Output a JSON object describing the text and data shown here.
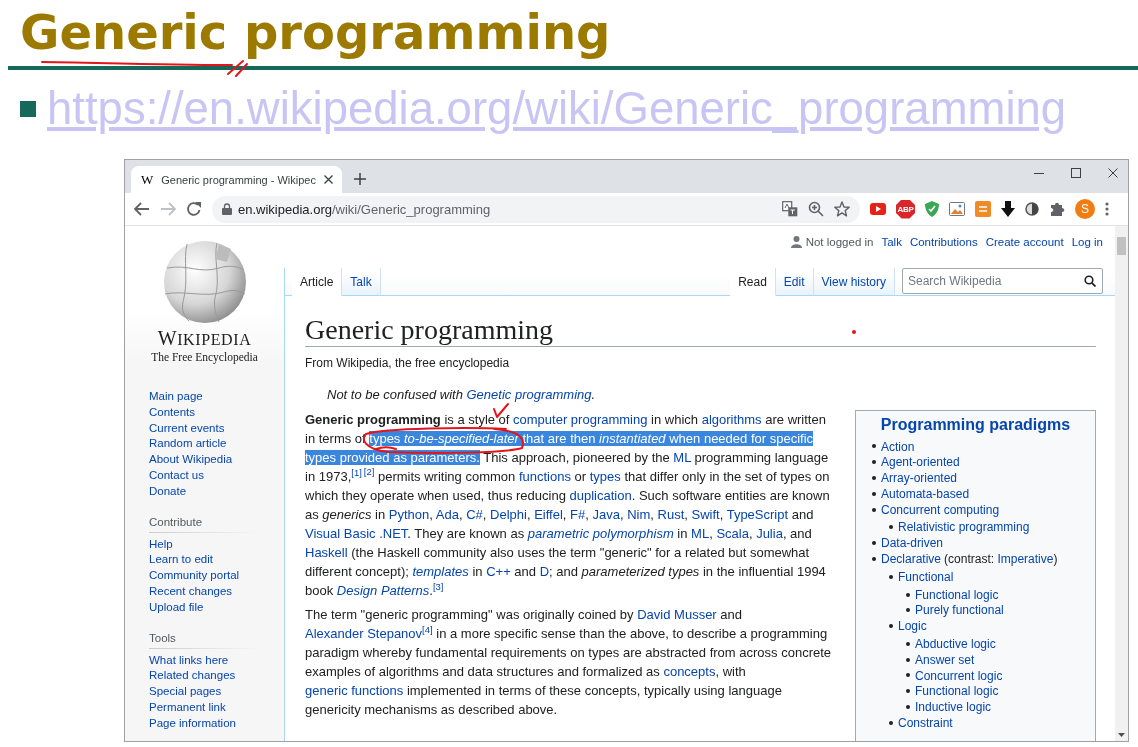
{
  "slide": {
    "title": "Generic programming",
    "bullet_link": "https://en.wikipedia.org/wiki/Generic_programming"
  },
  "ink_marks": [
    {
      "kind": "underline"
    },
    {
      "kind": "check"
    },
    {
      "kind": "circle"
    },
    {
      "kind": "dot"
    }
  ],
  "browser": {
    "tabs": [
      {
        "favicon": "W",
        "title": "Generic programming - Wikipec",
        "selected": true
      }
    ],
    "address": {
      "host": "en.wikipedia.org",
      "path": "/wiki/Generic_programming"
    },
    "extensions": [
      {
        "kind": "video"
      },
      {
        "kind": "octagon",
        "label": "ABP"
      },
      {
        "kind": "shield"
      },
      {
        "kind": "picture"
      },
      {
        "kind": "tile"
      },
      {
        "kind": "download"
      },
      {
        "kind": "circle"
      },
      {
        "kind": "puzzle"
      }
    ],
    "profile": {
      "initial": "S"
    }
  },
  "wiki": {
    "personal": [
      {
        "kind": "status",
        "text": "Not logged in"
      },
      {
        "kind": "link",
        "text": "Talk"
      },
      {
        "kind": "link",
        "text": "Contributions"
      },
      {
        "kind": "link",
        "text": "Create account"
      },
      {
        "kind": "link",
        "text": "Log in"
      }
    ],
    "logo": {
      "wordmark": "WIKIPEDIA",
      "tagline": "The Free Encyclopedia"
    },
    "sidebar": {
      "navigation": [
        "Main page",
        "Contents",
        "Current events",
        "Random article",
        "About Wikipedia",
        "Contact us",
        "Donate"
      ],
      "sections": [
        {
          "heading": "Contribute",
          "items": [
            "Help",
            "Learn to edit",
            "Community portal",
            "Recent changes",
            "Upload file"
          ]
        },
        {
          "heading": "Tools",
          "items": [
            "What links here",
            "Related changes",
            "Special pages",
            "Permanent link",
            "Page information"
          ]
        }
      ]
    },
    "namespace_tabs": [
      {
        "label": "Article",
        "selected": true
      },
      {
        "label": "Talk",
        "selected": false
      }
    ],
    "view_tabs": [
      {
        "label": "Read",
        "selected": true
      },
      {
        "label": "Edit",
        "selected": false
      },
      {
        "label": "View history",
        "selected": false
      }
    ],
    "search": {
      "placeholder": "Search Wikipedia"
    },
    "heading": "Generic programming",
    "tagline": "From Wikipedia, the free encyclopedia",
    "hatnote": [
      {
        "kind": "text",
        "text": "Not to be confused with "
      },
      {
        "kind": "link",
        "text": "Genetic programming"
      },
      {
        "kind": "text",
        "text": "."
      }
    ],
    "paragraphs": [
      [
        {
          "kind": "text",
          "text": "**Generic programming** is a style of "
        },
        {
          "kind": "link",
          "text": "computer programming"
        },
        {
          "kind": "text",
          "text": " in which "
        },
        {
          "kind": "link",
          "text": "algorithms"
        },
        {
          "kind": "text",
          "text": " are written in terms of "
        },
        {
          "kind": "highlighted",
          "text": "types *to-be-specified-later* that are then *instantiated* when needed for specific "
        },
        {
          "kind": "highlighted",
          "text": "types provided as parameters."
        },
        {
          "kind": "text",
          "text": " This approach, pioneered by the "
        },
        {
          "kind": "link",
          "text": "ML"
        },
        {
          "kind": "text",
          "text": " programming language in 1973,"
        },
        {
          "kind": "ref",
          "text": "[1]"
        },
        {
          "kind": "ref",
          "text": "[2]"
        },
        {
          "kind": "text",
          "text": " permits writing common "
        },
        {
          "kind": "link",
          "text": "functions"
        },
        {
          "kind": "text",
          "text": " or "
        },
        {
          "kind": "link",
          "text": "types"
        },
        {
          "kind": "text",
          "text": " that differ only in the set of types on which they operate when used, thus reducing "
        },
        {
          "kind": "link",
          "text": "duplication"
        },
        {
          "kind": "text",
          "text": ". Such software entities are known as *generics* in "
        },
        {
          "kind": "link",
          "text": "Python"
        },
        {
          "kind": "text",
          "text": ", "
        },
        {
          "kind": "link",
          "text": "Ada"
        },
        {
          "kind": "text",
          "text": ", "
        },
        {
          "kind": "link",
          "text": "C#"
        },
        {
          "kind": "text",
          "text": ", "
        },
        {
          "kind": "link",
          "text": "Delphi"
        },
        {
          "kind": "text",
          "text": ", "
        },
        {
          "kind": "link",
          "text": "Eiffel"
        },
        {
          "kind": "text",
          "text": ", "
        },
        {
          "kind": "link",
          "text": "F#"
        },
        {
          "kind": "text",
          "text": ", "
        },
        {
          "kind": "link",
          "text": "Java"
        },
        {
          "kind": "text",
          "text": ", "
        },
        {
          "kind": "link",
          "text": "Nim"
        },
        {
          "kind": "text",
          "text": ", "
        },
        {
          "kind": "link",
          "text": "Rust"
        },
        {
          "kind": "text",
          "text": ", "
        },
        {
          "kind": "link",
          "text": "Swift"
        },
        {
          "kind": "text",
          "text": ", "
        },
        {
          "kind": "link",
          "text": "TypeScript"
        },
        {
          "kind": "text",
          "text": " and "
        },
        {
          "kind": "link",
          "text": "Visual Basic .NET"
        },
        {
          "kind": "text",
          "text": ". They are known as "
        },
        {
          "kind": "italic-link",
          "text": "parametric polymorphism"
        },
        {
          "kind": "text",
          "text": " in "
        },
        {
          "kind": "link",
          "text": "ML"
        },
        {
          "kind": "text",
          "text": ", "
        },
        {
          "kind": "link",
          "text": "Scala"
        },
        {
          "kind": "text",
          "text": ", "
        },
        {
          "kind": "link",
          "text": "Julia"
        },
        {
          "kind": "text",
          "text": ", and "
        },
        {
          "kind": "link",
          "text": "Haskell"
        },
        {
          "kind": "text",
          "text": " (the Haskell community also uses the term \"generic\" for a related but somewhat different concept); "
        },
        {
          "kind": "italic-link",
          "text": "templates"
        },
        {
          "kind": "text",
          "text": " in "
        },
        {
          "kind": "link",
          "text": "C++"
        },
        {
          "kind": "text",
          "text": " and "
        },
        {
          "kind": "link",
          "text": "D"
        },
        {
          "kind": "text",
          "text": "; and *parameterized types* in the influential 1994 book "
        },
        {
          "kind": "italic-link",
          "text": "Design Patterns"
        },
        {
          "kind": "text",
          "text": "."
        },
        {
          "kind": "ref",
          "text": "[3]"
        }
      ],
      [
        {
          "kind": "text",
          "text": "The term \"generic programming\" was originally coined by "
        },
        {
          "kind": "link",
          "text": "David Musser"
        },
        {
          "kind": "text",
          "text": " and "
        },
        {
          "kind": "link",
          "text": "Alexander Stepanov"
        },
        {
          "kind": "ref",
          "text": "[4]"
        },
        {
          "kind": "text",
          "text": " in a more specific sense than the above, to describe a programming paradigm whereby fundamental requirements on types are abstracted from across concrete examples of algorithms and data structures and formalized as "
        },
        {
          "kind": "link",
          "text": "concepts"
        },
        {
          "kind": "text",
          "text": ", with "
        },
        {
          "kind": "link",
          "text": "generic functions"
        },
        {
          "kind": "text",
          "text": " implemented in terms of these concepts, typically using language genericity mechanisms as described above."
        }
      ]
    ],
    "infobox": {
      "title": "Programming paradigms",
      "items": [
        {
          "label": "Action"
        },
        {
          "label": "Agent-oriented"
        },
        {
          "label": "Array-oriented"
        },
        {
          "label": "Automata-based"
        },
        {
          "label": "Concurrent computing",
          "children": [
            {
              "label": "Relativistic programming"
            }
          ]
        },
        {
          "label": "Data-driven"
        },
        {
          "label": "Declarative",
          "note": [
            {
              "kind": "text",
              "text": "(contrast: "
            },
            {
              "kind": "link",
              "text": "Imperative"
            },
            {
              "kind": "text",
              "text": ")"
            }
          ],
          "children": [
            {
              "label": "Functional",
              "children": [
                {
                  "label": "Functional logic"
                },
                {
                  "label": "Purely functional"
                }
              ]
            },
            {
              "label": "Logic",
              "children": [
                {
                  "label": "Abductive logic"
                },
                {
                  "label": "Answer set"
                },
                {
                  "label": "Concurrent logic"
                },
                {
                  "label": "Functional logic"
                },
                {
                  "label": "Inductive logic"
                }
              ]
            },
            {
              "label": "Constraint"
            }
          ]
        }
      ]
    }
  }
}
